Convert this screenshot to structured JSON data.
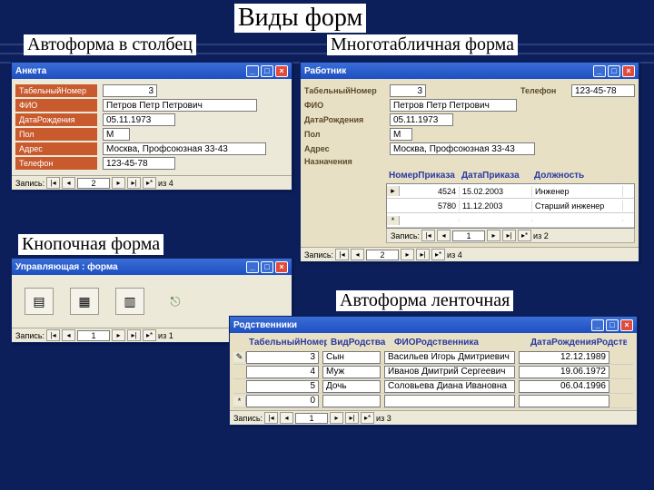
{
  "page_title": "Виды форм",
  "labels": {
    "sub_column": "Автоформа в столбец",
    "sub_multi": "Многотабличная форма",
    "sub_button": "Кнопочная форма",
    "sub_tape": "Автоформа ленточная"
  },
  "anketa": {
    "title": "Анкета",
    "fields": {
      "tab_no_label": "ТабельныйНомер",
      "tab_no": "3",
      "fio_label": "ФИО",
      "fio": "Петров Петр Петрович",
      "dob_label": "ДатаРождения",
      "dob": "05.11.1973",
      "pol_label": "Пол",
      "pol": "М",
      "addr_label": "Адрес",
      "addr": "Москва, Профсоюзная 33-43",
      "tel_label": "Телефон",
      "tel": "123-45-78"
    },
    "nav": {
      "label": "Запись:",
      "cur": "2",
      "of": "из 4"
    }
  },
  "rabotnik": {
    "title": "Работник",
    "fields": {
      "tab_no_label": "ТабельныйНомер",
      "tab_no": "3",
      "tel_label": "Телефон",
      "tel": "123-45-78",
      "fio_label": "ФИО",
      "fio": "Петров Петр Петрович",
      "dob_label": "ДатаРождения",
      "dob": "05.11.1973",
      "pol_label": "Пол",
      "pol": "М",
      "addr_label": "Адрес",
      "addr": "Москва, Профсоюзная 33-43",
      "nazn_label": "Назначения"
    },
    "subgrid": {
      "headers": {
        "h1": "НомерПриказа",
        "h2": "ДатаПриказа",
        "h3": "Должность"
      },
      "rows": [
        {
          "c1": "4524",
          "c2": "15.02.2003",
          "c3": "Инженер"
        },
        {
          "c1": "5780",
          "c2": "11.12.2003",
          "c3": "Старший инженер"
        }
      ],
      "nav": {
        "label": "Запись:",
        "cur": "1",
        "of": "из 2"
      }
    },
    "nav": {
      "label": "Запись:",
      "cur": "2",
      "of": "из 4"
    }
  },
  "upravl": {
    "title": "Управляющая : форма",
    "icons": {
      "b1": "form-icon",
      "b2": "form2-icon",
      "b3": "report-icon",
      "b4": "exit-icon"
    },
    "nav": {
      "label": "Запись:",
      "cur": "1",
      "of": "из 1"
    }
  },
  "rodstv": {
    "title": "Родственники",
    "headers": {
      "h1": "ТабельныйНомер",
      "h2": "ВидРодства",
      "h3": "ФИОРодственника",
      "h4": "ДатаРожденияРодственника"
    },
    "rows": [
      {
        "c1": "3",
        "c2": "Сын",
        "c3": "Васильев Игорь Дмитриевич",
        "c4": "12.12.1989"
      },
      {
        "c1": "4",
        "c2": "Муж",
        "c3": "Иванов Дмитрий Сергеевич",
        "c4": "19.06.1972"
      },
      {
        "c1": "5",
        "c2": "Дочь",
        "c3": "Соловьева Диана Ивановна",
        "c4": "06.04.1996"
      },
      {
        "c1": "0",
        "c2": "",
        "c3": "",
        "c4": ""
      }
    ],
    "nav": {
      "label": "Запись:",
      "cur": "1",
      "of": "из 3"
    }
  }
}
